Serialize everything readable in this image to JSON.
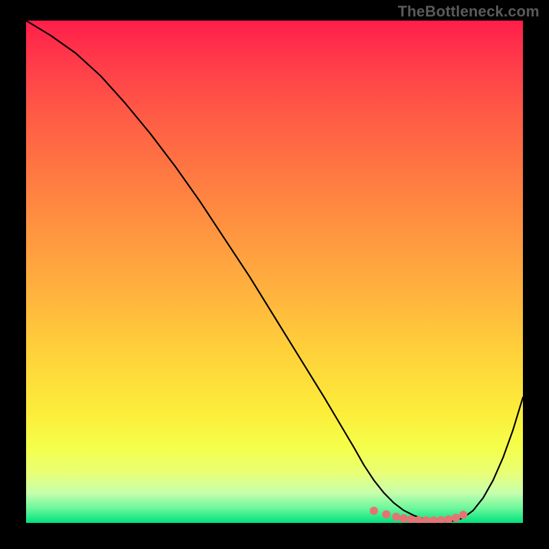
{
  "watermark": "TheBottleneck.com",
  "chart_data": {
    "type": "line",
    "title": "",
    "xlabel": "",
    "ylabel": "",
    "xlim": [
      0,
      100
    ],
    "ylim": [
      0,
      100
    ],
    "series": [
      {
        "name": "curve",
        "x": [
          0,
          5,
          10,
          15,
          20,
          25,
          30,
          35,
          40,
          45,
          50,
          55,
          60,
          63,
          66,
          68,
          70,
          72,
          74,
          76,
          78,
          80,
          82,
          84,
          86,
          88,
          90,
          92,
          94,
          96,
          98,
          100
        ],
        "y": [
          100,
          97,
          93.5,
          89,
          83.5,
          77.5,
          71,
          64,
          56.5,
          49,
          41,
          33,
          25,
          20,
          15,
          11.5,
          8.5,
          6,
          4,
          2.5,
          1.5,
          0.8,
          0.4,
          0.3,
          0.4,
          1,
          2.5,
          5,
          8.5,
          13,
          18.5,
          25
        ],
        "color": "#000000",
        "width": 2.2
      },
      {
        "name": "markers",
        "x": [
          70,
          72.5,
          74.5,
          76,
          77.5,
          79,
          80.5,
          82,
          83.5,
          85,
          86.5,
          88
        ],
        "y": [
          2.4,
          1.7,
          1.2,
          0.9,
          0.7,
          0.55,
          0.5,
          0.5,
          0.55,
          0.7,
          1.0,
          1.6
        ],
        "color": "#e57373",
        "marker_size": 12
      }
    ],
    "background_gradient": [
      "#ff1e4a",
      "#ff3a4a",
      "#ff5946",
      "#ff7742",
      "#ff9540",
      "#ffb23e",
      "#ffd13a",
      "#fced3a",
      "#f4ff4a",
      "#e9ff75",
      "#c7ffad",
      "#6ff79c",
      "#00e27e"
    ]
  }
}
